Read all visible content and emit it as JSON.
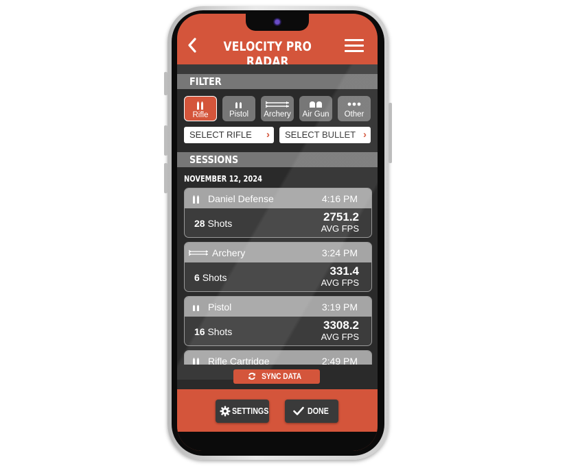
{
  "header": {
    "title": "VELOCITY PRO RADAR"
  },
  "filter": {
    "title": "FILTER",
    "types": [
      {
        "label": "Rifle",
        "icon": "rifle-icon",
        "active": true
      },
      {
        "label": "Pistol",
        "icon": "pistol-icon",
        "active": false
      },
      {
        "label": "Archery",
        "icon": "archery-icon",
        "active": false
      },
      {
        "label": "Air Gun",
        "icon": "air-gun-icon",
        "active": false
      },
      {
        "label": "Other",
        "icon": "more-icon",
        "active": false
      }
    ],
    "select_rifle": "SELECT RIFLE",
    "select_bullet": "SELECT BULLET"
  },
  "sessions": {
    "title": "SESSIONS",
    "date": "NOVEMBER 12, 2024",
    "items": [
      {
        "name": "Daniel Defense",
        "time": "4:16 PM",
        "shots_count": "28",
        "shots_label": "Shots",
        "fps": "2751.2",
        "fps_label": "AVG FPS",
        "icon": "rifle-icon"
      },
      {
        "name": "Archery",
        "time": "3:24 PM",
        "shots_count": "6",
        "shots_label": "Shots",
        "fps": "331.4",
        "fps_label": "AVG FPS",
        "icon": "archery-icon"
      },
      {
        "name": "Pistol",
        "time": "3:19 PM",
        "shots_count": "16",
        "shots_label": "Shots",
        "fps": "3308.2",
        "fps_label": "AVG FPS",
        "icon": "pistol-icon"
      },
      {
        "name": "Rifle Cartridge",
        "time": "2:49 PM",
        "shots_count": "",
        "shots_label": "",
        "fps": "",
        "fps_label": "",
        "icon": "rifle-icon"
      }
    ]
  },
  "actions": {
    "sync": "SYNC DATA",
    "settings": "SETTINGS",
    "done": "DONE"
  },
  "colors": {
    "accent": "#d4553b",
    "panel": "#3c3c3c",
    "bar": "#777777"
  }
}
